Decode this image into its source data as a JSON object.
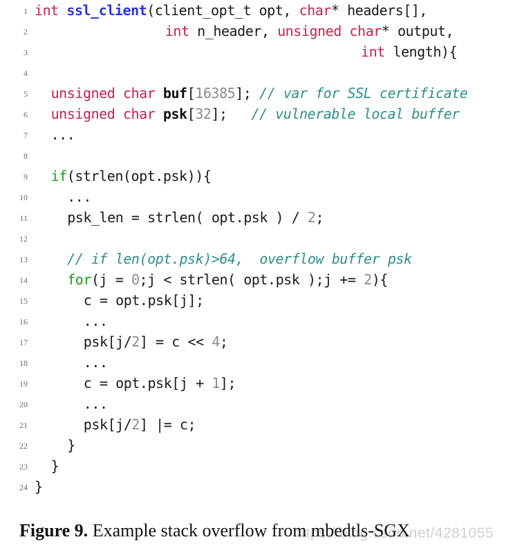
{
  "figure": {
    "caption_label": "Figure 9.",
    "caption_body": " Example stack overflow from mbedtls-SGX",
    "watermark": "https://blog.csdn.net/4281055"
  },
  "colors": {
    "type": "#c4214e",
    "function": "#2b35d6",
    "keyword": "#159e15",
    "comment": "#2e8c8c",
    "number": "#8a8a8a",
    "variable": "#101010",
    "plain": "#1a1a1a",
    "lineno": "#6b6b6b",
    "background": "#ffffff"
  },
  "listing": {
    "language": "C",
    "first_line": 1,
    "last_line": 24,
    "lines": [
      {
        "n": "1",
        "indent": 0,
        "tokens": [
          {
            "t": "int",
            "c": "type"
          },
          {
            "t": " ",
            "c": "plain"
          },
          {
            "t": "ssl_client",
            "c": "function"
          },
          {
            "t": "(client_opt_t opt, ",
            "c": "plain"
          },
          {
            "t": "char",
            "c": "type"
          },
          {
            "t": "* headers[],",
            "c": "plain"
          }
        ]
      },
      {
        "n": "2",
        "indent": 16,
        "tokens": [
          {
            "t": "int",
            "c": "type"
          },
          {
            "t": " n_header, ",
            "c": "plain"
          },
          {
            "t": "unsigned char",
            "c": "type"
          },
          {
            "t": "* output,",
            "c": "plain"
          }
        ]
      },
      {
        "n": "3",
        "indent": 40,
        "tokens": [
          {
            "t": "int",
            "c": "type"
          },
          {
            "t": " length){",
            "c": "plain"
          }
        ]
      },
      {
        "n": "4",
        "indent": 0,
        "tokens": []
      },
      {
        "n": "5",
        "indent": 2,
        "tokens": [
          {
            "t": "unsigned char",
            "c": "type"
          },
          {
            "t": " ",
            "c": "plain"
          },
          {
            "t": "buf",
            "c": "var"
          },
          {
            "t": "[",
            "c": "plain"
          },
          {
            "t": "16385",
            "c": "number"
          },
          {
            "t": "]; ",
            "c": "plain"
          },
          {
            "t": "// var for SSL certificate",
            "c": "comment"
          }
        ]
      },
      {
        "n": "6",
        "indent": 2,
        "tokens": [
          {
            "t": "unsigned char",
            "c": "type"
          },
          {
            "t": " ",
            "c": "plain"
          },
          {
            "t": "psk",
            "c": "var"
          },
          {
            "t": "[",
            "c": "plain"
          },
          {
            "t": "32",
            "c": "number"
          },
          {
            "t": "];   ",
            "c": "plain"
          },
          {
            "t": "// vulnerable local buffer",
            "c": "comment"
          }
        ]
      },
      {
        "n": "7",
        "indent": 2,
        "tokens": [
          {
            "t": "...",
            "c": "plain"
          }
        ]
      },
      {
        "n": "8",
        "indent": 0,
        "tokens": []
      },
      {
        "n": "9",
        "indent": 2,
        "tokens": [
          {
            "t": "if",
            "c": "keyword"
          },
          {
            "t": "(strlen(opt.psk)){",
            "c": "plain"
          }
        ]
      },
      {
        "n": "10",
        "indent": 4,
        "tokens": [
          {
            "t": "...",
            "c": "plain"
          }
        ]
      },
      {
        "n": "11",
        "indent": 4,
        "tokens": [
          {
            "t": "psk_len = strlen( opt.psk ) / ",
            "c": "plain"
          },
          {
            "t": "2",
            "c": "number"
          },
          {
            "t": ";",
            "c": "plain"
          }
        ]
      },
      {
        "n": "12",
        "indent": 0,
        "tokens": []
      },
      {
        "n": "13",
        "indent": 4,
        "tokens": [
          {
            "t": "// if len(opt.psk)>64,  overflow buffer psk",
            "c": "comment"
          }
        ]
      },
      {
        "n": "14",
        "indent": 4,
        "tokens": [
          {
            "t": "for",
            "c": "keyword"
          },
          {
            "t": "(j = ",
            "c": "plain"
          },
          {
            "t": "0",
            "c": "number"
          },
          {
            "t": ";j < strlen( opt.psk );j += ",
            "c": "plain"
          },
          {
            "t": "2",
            "c": "number"
          },
          {
            "t": "){",
            "c": "plain"
          }
        ]
      },
      {
        "n": "15",
        "indent": 6,
        "tokens": [
          {
            "t": "c = opt.psk[j];",
            "c": "plain"
          }
        ]
      },
      {
        "n": "16",
        "indent": 6,
        "tokens": [
          {
            "t": "...",
            "c": "plain"
          }
        ]
      },
      {
        "n": "17",
        "indent": 6,
        "tokens": [
          {
            "t": "psk[j/",
            "c": "plain"
          },
          {
            "t": "2",
            "c": "number"
          },
          {
            "t": "] = c << ",
            "c": "plain"
          },
          {
            "t": "4",
            "c": "number"
          },
          {
            "t": ";",
            "c": "plain"
          }
        ]
      },
      {
        "n": "18",
        "indent": 6,
        "tokens": [
          {
            "t": "...",
            "c": "plain"
          }
        ]
      },
      {
        "n": "19",
        "indent": 6,
        "tokens": [
          {
            "t": "c = opt.psk[j + ",
            "c": "plain"
          },
          {
            "t": "1",
            "c": "number"
          },
          {
            "t": "];",
            "c": "plain"
          }
        ]
      },
      {
        "n": "20",
        "indent": 6,
        "tokens": [
          {
            "t": "...",
            "c": "plain"
          }
        ]
      },
      {
        "n": "21",
        "indent": 6,
        "tokens": [
          {
            "t": "psk[j/",
            "c": "plain"
          },
          {
            "t": "2",
            "c": "number"
          },
          {
            "t": "] |= c;",
            "c": "plain"
          }
        ]
      },
      {
        "n": "22",
        "indent": 4,
        "tokens": [
          {
            "t": "}",
            "c": "plain"
          }
        ]
      },
      {
        "n": "23",
        "indent": 2,
        "tokens": [
          {
            "t": "}",
            "c": "plain"
          }
        ]
      },
      {
        "n": "24",
        "indent": 0,
        "tokens": [
          {
            "t": "}",
            "c": "plain"
          }
        ]
      }
    ]
  }
}
